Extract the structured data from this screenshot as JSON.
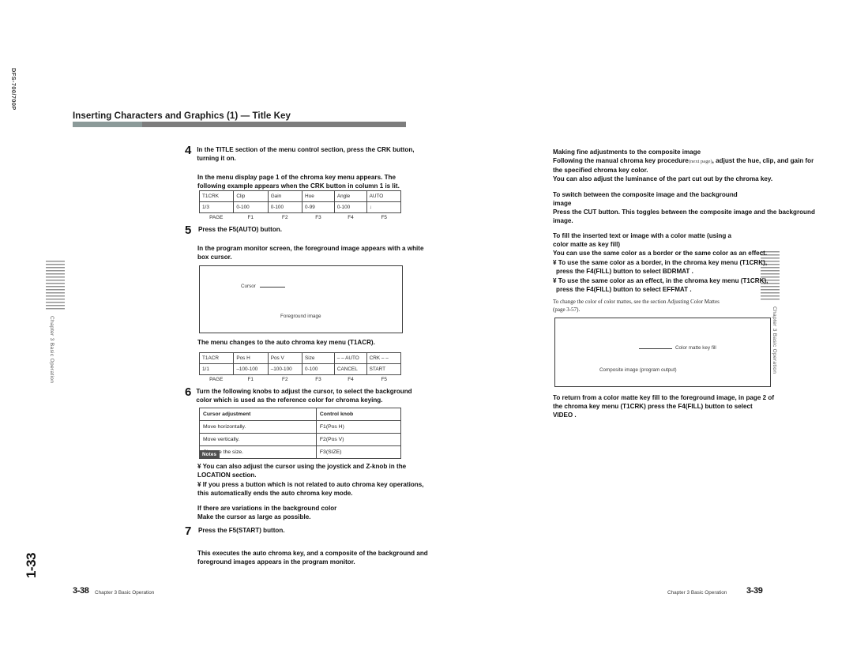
{
  "document": {
    "model": "DFS-700/700P",
    "spine_folio": "1-33"
  },
  "left_page": {
    "section_title": "Inserting Characters and Graphics (1) — Title Key",
    "steps": [
      {
        "number": "4",
        "text": "In the TITLE section of the menu control section, press the CRK button, turning it on."
      },
      {
        "number": "5",
        "text": "Press the F5(AUTO) button."
      },
      {
        "number": "6",
        "text": "Turn the following knobs to adjust the cursor, to select the background color which is used as the reference color for chroma keying."
      },
      {
        "number": "7",
        "text": "Press the F5(START) button."
      }
    ],
    "para_after_step4": "In the menu display page 1 of the chroma key menu appears. The following example appears when the CRK button in column 1 is lit.",
    "para_after_step5": "In the program monitor screen, the foreground image appears with a white box cursor.",
    "caption_menu_change": "The menu changes to the auto chroma key menu (T1ACR).",
    "para_after_step7": "This executes the auto chroma key, and a composite of the background and foreground images appears in the program monitor.",
    "menu_table_crk": {
      "row1": [
        "T1CRK",
        "Clip",
        "Gain",
        "Hue",
        "Angle",
        "AUTO"
      ],
      "row2": [
        "1/3",
        "0-100",
        "0-100",
        "0-99",
        "0-100",
        "↓"
      ],
      "fkeys": [
        "PAGE",
        "F1",
        "F2",
        "F3",
        "F4",
        "F5"
      ]
    },
    "menu_table_acr": {
      "row1": [
        "T1ACR",
        "Pos  H",
        "Pos  V",
        "Size",
        "– – AUTO",
        "CRK – –"
      ],
      "row2": [
        "1/1",
        "–100-100",
        "–100-100",
        "0-100",
        "CANCEL",
        "START"
      ],
      "fkeys": [
        "PAGE",
        "F1",
        "F2",
        "F3",
        "F4",
        "F5"
      ]
    },
    "monitor_cursor": {
      "label_cursor": "Cursor",
      "label_foreground": "Foreground image"
    },
    "cursor_table": {
      "headers": [
        "Cursor adjustment",
        "Control knob"
      ],
      "rows": [
        [
          "Move horizontally.",
          "F1(Pos H)"
        ],
        [
          "Move vertically.",
          "F2(Pos V)"
        ],
        [
          "Change the size.",
          "F3(SIZE)"
        ]
      ]
    },
    "notes": {
      "badge": "Notes",
      "items": [
        "¥ You can also adjust the cursor using the joystick and Z-knob in the LOCATION section.",
        "¥ If you press a button which is not related to auto chroma key operations, this automatically ends the auto chroma key mode."
      ]
    },
    "variation_note": {
      "line1": "If there are variations in the background color",
      "line2": "Make the cursor as large as possible."
    },
    "footer": {
      "page_number": "3-38",
      "chapter": "Chapter 3  Basic Operation"
    }
  },
  "right_page": {
    "blocks": [
      {
        "heading": "Making fine adjustments to the composite image",
        "body_a": "Following the manual chroma key procedure",
        "body_ref": "(next page)",
        "body_b": ", adjust the hue, clip, and gain for the specified chroma key color.",
        "body_c": "You can also adjust the luminance of the part cut out by the chroma key."
      },
      {
        "heading_line1": "To switch between the composite image and the background",
        "heading_line2": "image",
        "body": "Press the CUT button. This toggles between the composite image and the background image."
      },
      {
        "heading_line1": "To fill the inserted text or image with a color matte (using a",
        "heading_line2": "color matte as key fill)",
        "body": "You can use the same color as a border or the same color as an effect.",
        "bullet1_line1": "¥ To use the same color as a border, in the chroma key menu (T1CRK),",
        "bullet1_line2": "press the F4(FILL) button to select  BDRMAT .",
        "bullet2_line1": "¥ To use the same color as an effect, in the chroma key menu (T1CRK),",
        "bullet2_line2": "press the F4(FILL) button to select  EFFMAT ."
      }
    ],
    "ref_note": {
      "line1": "To change the color of color mattes, see the section  Adjusting Color Mattes",
      "line2": "(page 3-57)."
    },
    "monitor_matte": {
      "label_key_fill": "Color matte key fill",
      "label_composite": "Composite image (program output)"
    },
    "closing_paragraph": {
      "line1": "To return from a color matte key fill to the foreground image, in page 2 of",
      "line2": "the chroma key menu (T1CRK) press the F4(FILL) button to select",
      "line3": " VIDEO ."
    },
    "footer": {
      "chapter": "Chapter 3  Basic Operation",
      "page_number": "3-39"
    }
  },
  "margin": {
    "vertical_chapter": "Chapter 3   Basic Operation"
  },
  "colors": {
    "rule_accent": "#8b9a99",
    "rule_main": "#7d7d7d",
    "notes_badge": "#4f4f4f",
    "table_border": "#4a4a4a"
  }
}
